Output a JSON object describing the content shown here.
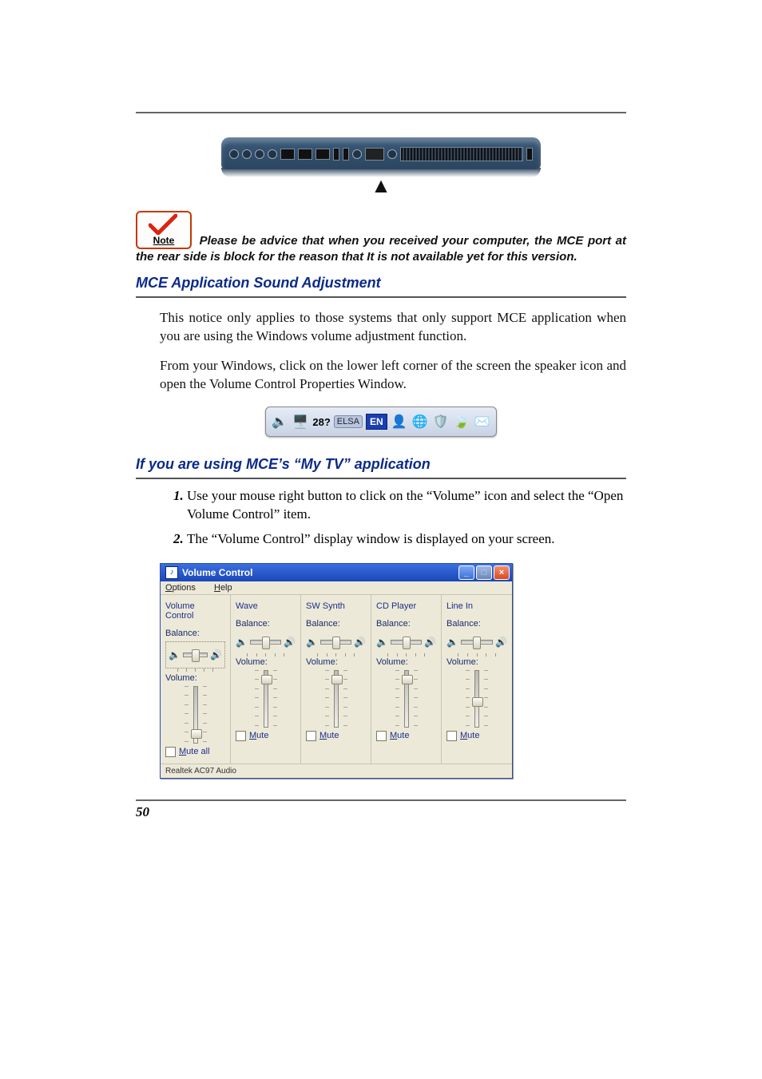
{
  "note": {
    "badge_label": "Note",
    "text": "Please be advice that when you received your computer, the MCE port at the rear side is block for the reason that It is not available yet for this version."
  },
  "heading1": "MCE Application Sound Adjustment",
  "para1": "This notice only applies to those systems that only support MCE application when you are using the Windows volume adjustment function.",
  "para2": "From your Windows, click on the lower left corner of the screen the speaker icon and open the Volume Control Properties Window.",
  "taskbar": {
    "text_28": "28?",
    "pill": "ELSA",
    "lang": "EN"
  },
  "heading2": "If you are using MCE’s “My TV” application",
  "steps": [
    "Use your mouse right button to click on the “Volume” icon and select the “Open Volume Control” item.",
    "The “Volume Control” display window is displayed on your screen."
  ],
  "vc": {
    "title": "Volume Control",
    "menu": {
      "options": "Options",
      "help": "Help"
    },
    "balance_label": "Balance:",
    "volume_label": "Volume:",
    "mute_all": "Mute all",
    "mute": "Mute",
    "status": "Realtek AC97 Audio",
    "cols": [
      {
        "name": "Volume Control",
        "thumb_pct": 88,
        "mute_label_key": "mute_all"
      },
      {
        "name": "Wave",
        "thumb_pct": 8,
        "mute_label_key": "mute"
      },
      {
        "name": "SW Synth",
        "thumb_pct": 8,
        "mute_label_key": "mute"
      },
      {
        "name": "CD Player",
        "thumb_pct": 8,
        "mute_label_key": "mute"
      },
      {
        "name": "Line In",
        "thumb_pct": 55,
        "mute_label_key": "mute"
      }
    ]
  },
  "page_number": "50"
}
